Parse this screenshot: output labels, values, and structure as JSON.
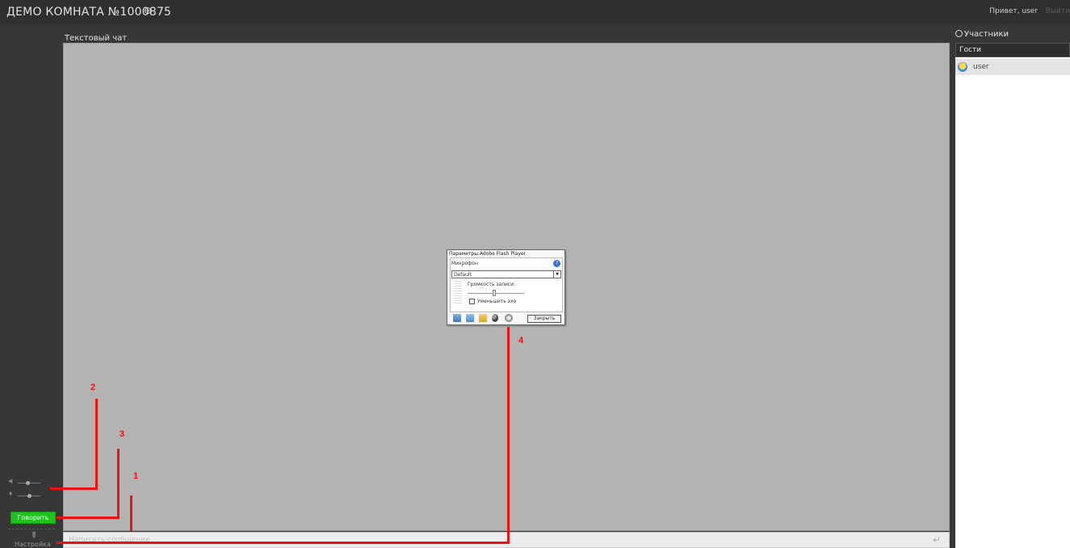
{
  "header": {
    "room_title": "ДЕМО КОМНАТА №1000875",
    "greeting": "Привет, user",
    "logout": "Выйти"
  },
  "sidebar": {
    "talk_button": "Говорить",
    "settings_label": "Настройка"
  },
  "chat": {
    "title": "Текстовый чат",
    "input_placeholder": "Написать сообщение"
  },
  "flash_dialog": {
    "title": "Параметры Adobe Flash Player",
    "section": "Микрофон",
    "device": "Default",
    "volume_label": "Громкость записи:",
    "echo_label": "Уменьшить эхо",
    "close_button": "Закрыть",
    "echo_checked": false
  },
  "participants": {
    "title": "Участники",
    "group": "Гости",
    "users": [
      "user"
    ]
  },
  "annotations": [
    "1",
    "2",
    "3",
    "4"
  ],
  "colors": {
    "talk_button": "#1fc31f",
    "annotation": "#e11111",
    "chat_bg": "#b3b3b3"
  }
}
